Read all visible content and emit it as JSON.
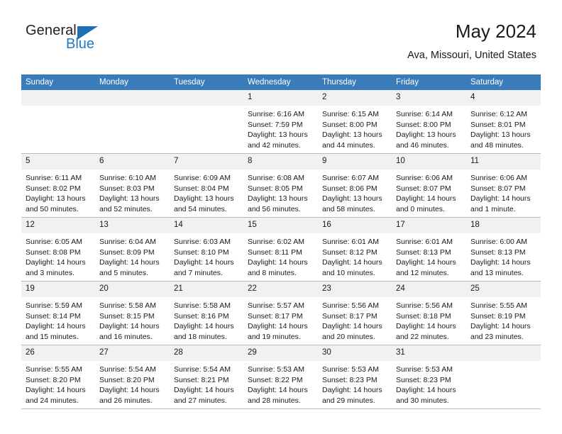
{
  "brand": {
    "name_line1": "General",
    "name_line2": "Blue",
    "logo_icon": "blue-triangle-icon",
    "color_dark": "#231f20",
    "color_blue": "#1f7ac4"
  },
  "header": {
    "title": "May 2024",
    "location": "Ava, Missouri, United States",
    "header_bg": "#3a7cba",
    "daynum_bg": "#f1f1f1"
  },
  "weekday_headers": [
    "Sunday",
    "Monday",
    "Tuesday",
    "Wednesday",
    "Thursday",
    "Friday",
    "Saturday"
  ],
  "labels": {
    "sunrise_prefix": "Sunrise:",
    "sunset_prefix": "Sunset:",
    "daylight_prefix": "Daylight:"
  },
  "weeks": [
    [
      {
        "day": "",
        "blank": true
      },
      {
        "day": "",
        "blank": true
      },
      {
        "day": "",
        "blank": true
      },
      {
        "day": "1",
        "sunrise": "Sunrise: 6:16 AM",
        "sunset": "Sunset: 7:59 PM",
        "daylight": "Daylight: 13 hours and 42 minutes."
      },
      {
        "day": "2",
        "sunrise": "Sunrise: 6:15 AM",
        "sunset": "Sunset: 8:00 PM",
        "daylight": "Daylight: 13 hours and 44 minutes."
      },
      {
        "day": "3",
        "sunrise": "Sunrise: 6:14 AM",
        "sunset": "Sunset: 8:00 PM",
        "daylight": "Daylight: 13 hours and 46 minutes."
      },
      {
        "day": "4",
        "sunrise": "Sunrise: 6:12 AM",
        "sunset": "Sunset: 8:01 PM",
        "daylight": "Daylight: 13 hours and 48 minutes."
      }
    ],
    [
      {
        "day": "5",
        "sunrise": "Sunrise: 6:11 AM",
        "sunset": "Sunset: 8:02 PM",
        "daylight": "Daylight: 13 hours and 50 minutes."
      },
      {
        "day": "6",
        "sunrise": "Sunrise: 6:10 AM",
        "sunset": "Sunset: 8:03 PM",
        "daylight": "Daylight: 13 hours and 52 minutes."
      },
      {
        "day": "7",
        "sunrise": "Sunrise: 6:09 AM",
        "sunset": "Sunset: 8:04 PM",
        "daylight": "Daylight: 13 hours and 54 minutes."
      },
      {
        "day": "8",
        "sunrise": "Sunrise: 6:08 AM",
        "sunset": "Sunset: 8:05 PM",
        "daylight": "Daylight: 13 hours and 56 minutes."
      },
      {
        "day": "9",
        "sunrise": "Sunrise: 6:07 AM",
        "sunset": "Sunset: 8:06 PM",
        "daylight": "Daylight: 13 hours and 58 minutes."
      },
      {
        "day": "10",
        "sunrise": "Sunrise: 6:06 AM",
        "sunset": "Sunset: 8:07 PM",
        "daylight": "Daylight: 14 hours and 0 minutes."
      },
      {
        "day": "11",
        "sunrise": "Sunrise: 6:06 AM",
        "sunset": "Sunset: 8:07 PM",
        "daylight": "Daylight: 14 hours and 1 minute."
      }
    ],
    [
      {
        "day": "12",
        "sunrise": "Sunrise: 6:05 AM",
        "sunset": "Sunset: 8:08 PM",
        "daylight": "Daylight: 14 hours and 3 minutes."
      },
      {
        "day": "13",
        "sunrise": "Sunrise: 6:04 AM",
        "sunset": "Sunset: 8:09 PM",
        "daylight": "Daylight: 14 hours and 5 minutes."
      },
      {
        "day": "14",
        "sunrise": "Sunrise: 6:03 AM",
        "sunset": "Sunset: 8:10 PM",
        "daylight": "Daylight: 14 hours and 7 minutes."
      },
      {
        "day": "15",
        "sunrise": "Sunrise: 6:02 AM",
        "sunset": "Sunset: 8:11 PM",
        "daylight": "Daylight: 14 hours and 8 minutes."
      },
      {
        "day": "16",
        "sunrise": "Sunrise: 6:01 AM",
        "sunset": "Sunset: 8:12 PM",
        "daylight": "Daylight: 14 hours and 10 minutes."
      },
      {
        "day": "17",
        "sunrise": "Sunrise: 6:01 AM",
        "sunset": "Sunset: 8:13 PM",
        "daylight": "Daylight: 14 hours and 12 minutes."
      },
      {
        "day": "18",
        "sunrise": "Sunrise: 6:00 AM",
        "sunset": "Sunset: 8:13 PM",
        "daylight": "Daylight: 14 hours and 13 minutes."
      }
    ],
    [
      {
        "day": "19",
        "sunrise": "Sunrise: 5:59 AM",
        "sunset": "Sunset: 8:14 PM",
        "daylight": "Daylight: 14 hours and 15 minutes."
      },
      {
        "day": "20",
        "sunrise": "Sunrise: 5:58 AM",
        "sunset": "Sunset: 8:15 PM",
        "daylight": "Daylight: 14 hours and 16 minutes."
      },
      {
        "day": "21",
        "sunrise": "Sunrise: 5:58 AM",
        "sunset": "Sunset: 8:16 PM",
        "daylight": "Daylight: 14 hours and 18 minutes."
      },
      {
        "day": "22",
        "sunrise": "Sunrise: 5:57 AM",
        "sunset": "Sunset: 8:17 PM",
        "daylight": "Daylight: 14 hours and 19 minutes."
      },
      {
        "day": "23",
        "sunrise": "Sunrise: 5:56 AM",
        "sunset": "Sunset: 8:17 PM",
        "daylight": "Daylight: 14 hours and 20 minutes."
      },
      {
        "day": "24",
        "sunrise": "Sunrise: 5:56 AM",
        "sunset": "Sunset: 8:18 PM",
        "daylight": "Daylight: 14 hours and 22 minutes."
      },
      {
        "day": "25",
        "sunrise": "Sunrise: 5:55 AM",
        "sunset": "Sunset: 8:19 PM",
        "daylight": "Daylight: 14 hours and 23 minutes."
      }
    ],
    [
      {
        "day": "26",
        "sunrise": "Sunrise: 5:55 AM",
        "sunset": "Sunset: 8:20 PM",
        "daylight": "Daylight: 14 hours and 24 minutes."
      },
      {
        "day": "27",
        "sunrise": "Sunrise: 5:54 AM",
        "sunset": "Sunset: 8:20 PM",
        "daylight": "Daylight: 14 hours and 26 minutes."
      },
      {
        "day": "28",
        "sunrise": "Sunrise: 5:54 AM",
        "sunset": "Sunset: 8:21 PM",
        "daylight": "Daylight: 14 hours and 27 minutes."
      },
      {
        "day": "29",
        "sunrise": "Sunrise: 5:53 AM",
        "sunset": "Sunset: 8:22 PM",
        "daylight": "Daylight: 14 hours and 28 minutes."
      },
      {
        "day": "30",
        "sunrise": "Sunrise: 5:53 AM",
        "sunset": "Sunset: 8:23 PM",
        "daylight": "Daylight: 14 hours and 29 minutes."
      },
      {
        "day": "31",
        "sunrise": "Sunrise: 5:53 AM",
        "sunset": "Sunset: 8:23 PM",
        "daylight": "Daylight: 14 hours and 30 minutes."
      },
      {
        "day": "",
        "blank": true
      }
    ]
  ]
}
